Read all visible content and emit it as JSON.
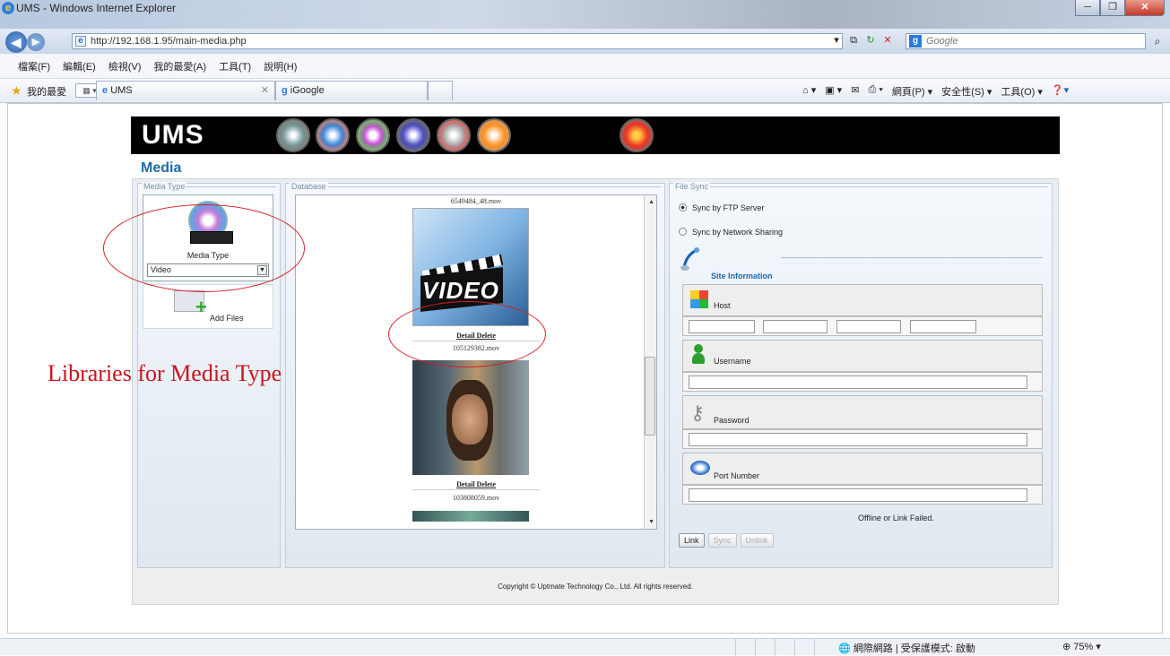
{
  "browser": {
    "window_title": "UMS - Windows Internet Explorer",
    "address": "http://192.168.1.95/main-media.php",
    "search_placeholder": "Google",
    "menu": [
      "檔案(F)",
      "編輯(E)",
      "檢視(V)",
      "我的最愛(A)",
      "工具(T)",
      "說明(H)"
    ],
    "favorites_label": "我的最愛",
    "tabs": [
      {
        "label": "UMS"
      },
      {
        "label": "iGoogle"
      }
    ],
    "command_bar": [
      "網頁(P) ▾",
      "安全性(S) ▾",
      "工具(O) ▾"
    ],
    "status_zone": "網際網路 | 受保護模式: 啟動",
    "zoom": "75%"
  },
  "app": {
    "logo": "UMS",
    "page_title": "Media",
    "nav_icons": [
      "settings-icon",
      "network-icon",
      "media-icon",
      "grid-icon",
      "schedule-icon",
      "broadcast-icon",
      "logout-icon"
    ],
    "active_nav": 2
  },
  "media_type_panel": {
    "legend": "Media Type",
    "icon_label": "Media Type",
    "selected": "Video",
    "add_files_label": "Add Files"
  },
  "database_panel": {
    "legend": "Database",
    "items": [
      {
        "filename_top": "6549484_48.mov"
      },
      {
        "detail_label": "Detail",
        "delete_label": "Delete",
        "filename": "105129382.mov"
      },
      {
        "detail_label": "Detail",
        "delete_label": "Delete",
        "filename": "103808059.mov"
      }
    ]
  },
  "file_sync_panel": {
    "legend": "File Sync",
    "options": [
      {
        "label": "Sync by FTP Server",
        "selected": true
      },
      {
        "label": "Sync by Network Sharing",
        "selected": false
      }
    ],
    "site_info_label": "Site Information",
    "fields": {
      "host": "Host",
      "username": "Username",
      "password": "Password",
      "port": "Port Number"
    },
    "status": "Offline or Link Failed.",
    "buttons": {
      "link": "Link",
      "sync": "Sync",
      "unlink": "Unlink"
    }
  },
  "footer": {
    "copyright": "Copyright © Uptmate Technology Co., Ltd. All rights reserved."
  },
  "annotation": {
    "text": "Libraries for Media Type"
  }
}
